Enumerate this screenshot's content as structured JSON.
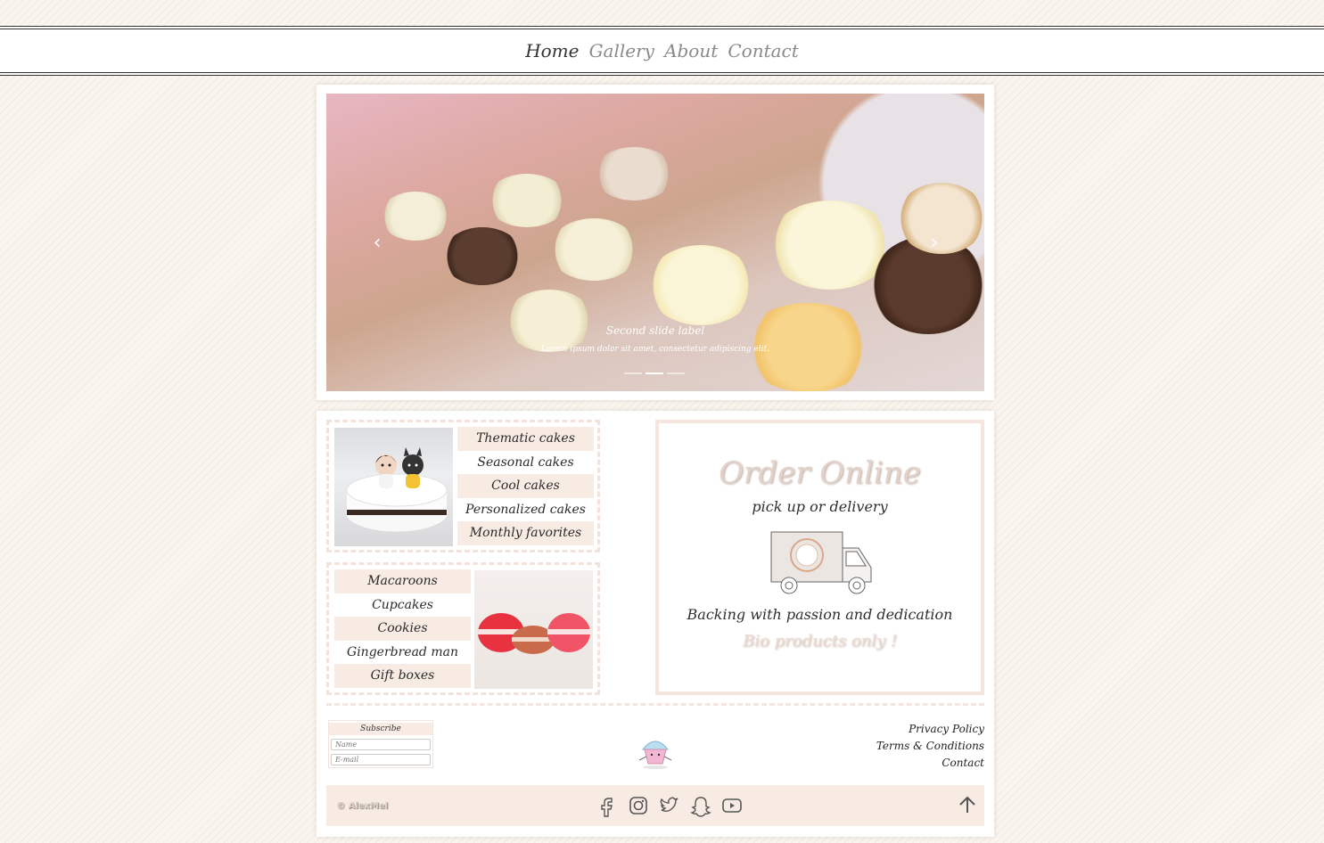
{
  "nav": {
    "items": [
      {
        "label": "Home",
        "active": true
      },
      {
        "label": "Gallery",
        "active": false
      },
      {
        "label": "About",
        "active": false
      },
      {
        "label": "Contact",
        "active": false
      }
    ]
  },
  "carousel": {
    "caption_title": "Second slide label",
    "caption_text": "Lorem ipsum dolor sit amet, consectetur adipiscing elit.",
    "prev_icon": "chevron-left-icon",
    "next_icon": "chevron-right-icon",
    "slide_count": 3,
    "active_slide": 2
  },
  "cakes_menu": {
    "items": [
      "Thematic cakes",
      "Seasonal cakes",
      "Cool cakes",
      "Personalized cakes",
      "Monthly favorites"
    ]
  },
  "sweets_menu": {
    "items": [
      "Macaroons",
      "Cupcakes",
      "Cookies",
      "Gingerbread man",
      "Gift boxes"
    ]
  },
  "order": {
    "title": "Order Online",
    "subtitle": "pick up or delivery",
    "tagline": "Backing with passion and dedication",
    "bio": "Bio products only !"
  },
  "subscribe": {
    "label": "Subscribe",
    "name_placeholder": "Name",
    "email_placeholder": "E-mail"
  },
  "footer": {
    "links": [
      "Privacy Policy",
      "Terms & Conditions",
      "Contact"
    ],
    "copyright": "© AlexMel",
    "social": [
      "facebook-icon",
      "instagram-icon",
      "twitter-icon",
      "snapchat-icon",
      "youtube-icon"
    ]
  },
  "colors": {
    "accent_bg": "#f7ebe4",
    "border": "#f4e6df",
    "page_bg": "#fbf5ef"
  }
}
